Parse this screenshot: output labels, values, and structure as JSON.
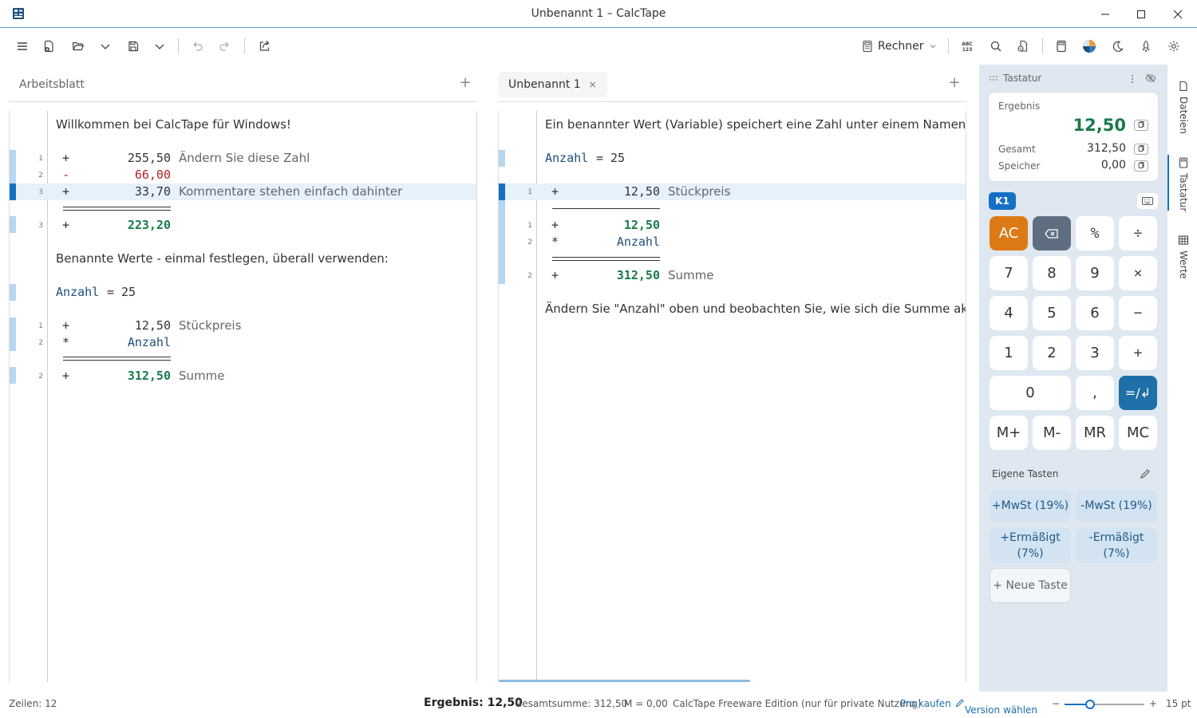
{
  "window": {
    "title": "Unbenannt 1  –  CalcTape"
  },
  "toolbar": {
    "mode_label": "Rechner"
  },
  "left_panel": {
    "tab_label": "Arbeitsblatt",
    "welcome": "Willkommen bei CalcTape für Windows!",
    "l1_op": "+",
    "l1_num": "255,50",
    "l1_cmt": "Ändern Sie diese Zahl",
    "l1_n": "1",
    "l2_op": "-",
    "l2_num": "66,00",
    "l2_n": "2",
    "l3_op": "+",
    "l3_num": "33,70",
    "l3_cmt": "Kommentare stehen einfach dahinter",
    "l3_n": "3",
    "sum_op": "+",
    "sum_num": "223,20",
    "sum_n": "3",
    "named_intro": "Benannte Werte - einmal festlegen, überall verwenden:",
    "var_name": "Anzahl",
    "var_eq": "=",
    "var_val": "25",
    "p1_op": "+",
    "p1_num": "12,50",
    "p1_cmt": "Stückpreis",
    "p1_n": "1",
    "p2_op": "*",
    "p2_num": "Anzahl",
    "p2_n": "2",
    "ps_op": "+",
    "ps_num": "312,50",
    "ps_cmt": "Summe",
    "ps_n": "2"
  },
  "right_panel": {
    "tab_label": "Unbenannt 1",
    "tab_close": "×",
    "intro": "Ein benannter Wert (Variable) speichert eine Zahl unter einem Namen - verwer",
    "var_name": "Anzahl",
    "var_eq": "=",
    "var_val": "25",
    "r1_op": "+",
    "r1_num": "12,50",
    "r1_cmt": "Stückpreis",
    "r1_n": "1",
    "r2_op": "+",
    "r2_num": "12,50",
    "r2_n": "1",
    "r3_op": "*",
    "r3_num": "Anzahl",
    "r3_n": "2",
    "rs_op": "+",
    "rs_num": "312,50",
    "rs_cmt": "Summe",
    "rs_n": "2",
    "outro": "Ändern Sie \"Anzahl\" oben und beobachten Sie, wie sich die Summe aktualisiert"
  },
  "keypad": {
    "header": "Tastatur",
    "result_label": "Ergebnis",
    "result_value": "12,50",
    "total_label": "Gesamt",
    "total_value": "312,50",
    "memory_label": "Speicher",
    "memory_value": "0,00",
    "badge": "K1",
    "keys": {
      "ac": "AC",
      "pct": "%",
      "div": "÷",
      "k7": "7",
      "k8": "8",
      "k9": "9",
      "mul": "×",
      "k4": "4",
      "k5": "5",
      "k6": "6",
      "sub": "−",
      "k1": "1",
      "k2": "2",
      "k3": "3",
      "add": "+",
      "k0": "0",
      "comma": ",",
      "eq": "=/↲",
      "mplus": "M+",
      "mminus": "M-",
      "mr": "MR",
      "mc": "MC"
    },
    "custom_label": "Eigene Tasten",
    "custom_keys": [
      "+MwSt (19%)",
      "-MwSt (19%)",
      "+Ermäßigt (7%)",
      "-Ermäßigt (7%)"
    ],
    "new_key": "+ Neue Taste"
  },
  "side_tabs": {
    "files": "Dateien",
    "keyboard": "Tastatur",
    "values": "Werte"
  },
  "status": {
    "lines": "Zeilen: 12",
    "result": "Ergebnis: 12,50",
    "total": "Gesamtsumme: 312,50",
    "memory": "M = 0,00",
    "edition": "CalcTape Freeware Edition (nur für private Nutzung)",
    "buy": "Pro kaufen",
    "version": "Version wählen",
    "zoom": "15 pt"
  },
  "colors": {
    "accent": "#1f6fa8",
    "ac_key": "#dd7a16",
    "green_result": "#1a7a4c",
    "negative": "#b22222"
  }
}
